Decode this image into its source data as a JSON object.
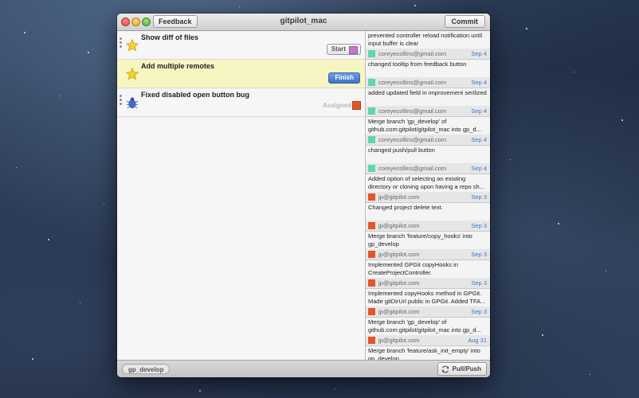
{
  "window": {
    "title": "gitpilot_mac",
    "feedback_label": "Feedback",
    "commit_label": "Commit"
  },
  "tasks": [
    {
      "title": "Show diff of files",
      "action": "Start",
      "icon": "star-icon",
      "swatch_color": "#c178c8"
    },
    {
      "title": "Add multiple remotes",
      "action": "Finish",
      "icon": "star-icon",
      "selected": true
    },
    {
      "title": "Fixed disabled open button bug",
      "status": "Assigned",
      "icon": "bug-icon",
      "swatch_color": "#e0572a"
    }
  ],
  "commits": [
    {
      "message": "prevented controller reload notification until input buffer is clear",
      "author": "coreyecollins@gmail.com",
      "date": "Sep 4",
      "color": "#5fd6b0"
    },
    {
      "message": "changed tooltip from feedback button",
      "author": "coreyecollins@gmail.com",
      "date": "Sep 4",
      "color": "#5fd6b0"
    },
    {
      "message": "added updated field in improvement serilized",
      "author": "coreyecollins@gmail.com",
      "date": "Sep 4",
      "color": "#5fd6b0"
    },
    {
      "message": "Merge branch 'gp_develop' of github.com:gitpilot/gitpilot_mac into gp_d...",
      "author": "coreyecollins@gmail.com",
      "date": "Sep 4",
      "color": "#5fd6b0"
    },
    {
      "message": "changed push/pull button",
      "author": "coreyecollins@gmail.com",
      "date": "Sep 4",
      "color": "#5fd6b0"
    },
    {
      "message": "Added option of selecting an existing directory or cloning upon having a repo sh...",
      "author": "jp@gitpilot.com",
      "date": "Sep 3",
      "color": "#e0572a"
    },
    {
      "message": "Changed project delete text.",
      "author": "jp@gitpilot.com",
      "date": "Sep 3",
      "color": "#e0572a"
    },
    {
      "message": "Merge branch 'feature/copy_hooks' into gp_develop",
      "author": "jp@gitpilot.com",
      "date": "Sep 3",
      "color": "#e0572a"
    },
    {
      "message": "Implemented GPGit copyHooks in CreateProjectController.",
      "author": "jp@gitpilot.com",
      "date": "Sep 3",
      "color": "#e0572a"
    },
    {
      "message": "Implemented copyHooks method in GPGit. Made gitDirUrl public in GPGit. Added TFA...",
      "author": "jp@gitpilot.com",
      "date": "Sep 3",
      "color": "#e0572a"
    },
    {
      "message": "Merge branch 'gp_develop' of github.com:gitpilot/gitpilot_mac into gp_d...",
      "author": "jp@gitpilot.com",
      "date": "Aug 31",
      "color": "#e0572a"
    },
    {
      "message": "Merge branch 'feature/ask_init_empty' into gp_develop",
      "author": "",
      "date": "",
      "color": "#e0572a"
    }
  ],
  "bottombar": {
    "branch": "gp_develop",
    "pull_push_label": "Pull/Push"
  }
}
